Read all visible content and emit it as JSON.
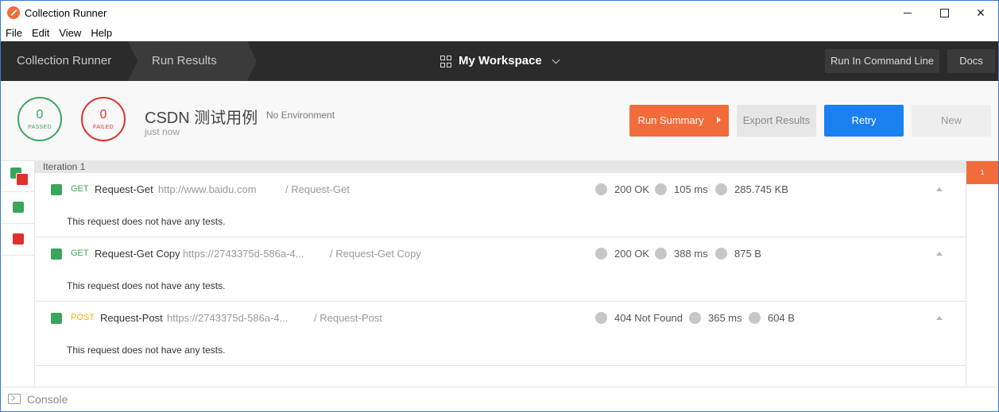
{
  "window": {
    "title": "Collection Runner"
  },
  "menu": [
    "File",
    "Edit",
    "View",
    "Help"
  ],
  "header": {
    "crumb_runner": "Collection Runner",
    "crumb_results": "Run Results",
    "workspace": "My Workspace",
    "run_cmd": "Run In Command Line",
    "docs": "Docs"
  },
  "summary": {
    "passed_count": "0",
    "passed_label": "PASSED",
    "failed_count": "0",
    "failed_label": "FAILED",
    "collection_name": "CSDN 测试用例",
    "environment": "No Environment",
    "time": "just now",
    "run_summary": "Run Summary",
    "export": "Export Results",
    "retry": "Retry",
    "new": "New"
  },
  "iteration": {
    "label": "Iteration 1",
    "tab": "1"
  },
  "requests": [
    {
      "method": "GET",
      "name": "Request-Get",
      "url": "http://www.baidu.com",
      "path": "/ Request-Get",
      "status": "200 OK",
      "time": "105 ms",
      "size": "285.745 KB",
      "tests": "This request does not have any tests."
    },
    {
      "method": "GET",
      "name": "Request-Get Copy",
      "url": "https://2743375d-586a-4...",
      "path": "/ Request-Get Copy",
      "status": "200 OK",
      "time": "388 ms",
      "size": "875 B",
      "tests": "This request does not have any tests."
    },
    {
      "method": "POST",
      "name": "Request-Post",
      "url": "https://2743375d-586a-4...",
      "path": "/ Request-Post",
      "status": "404 Not Found",
      "time": "365 ms",
      "size": "604 B",
      "tests": "This request does not have any tests."
    }
  ],
  "console": {
    "label": "Console"
  },
  "colors": {
    "accent": "#f26b3a",
    "pass": "#3aa55d",
    "fail": "#e0302b",
    "primary": "#1a80f0",
    "header": "#2b2b2b"
  }
}
